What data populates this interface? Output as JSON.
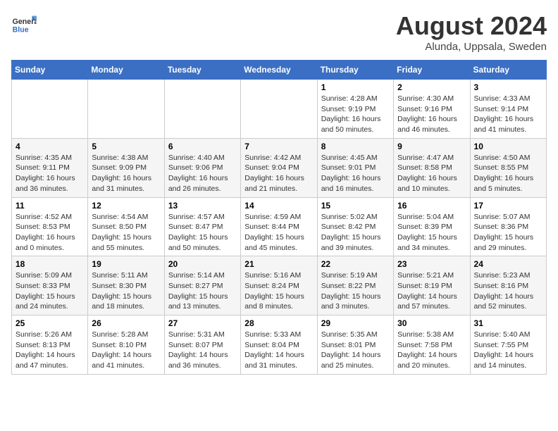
{
  "logo": {
    "line1": "General",
    "line2": "Blue"
  },
  "title": "August 2024",
  "location": "Alunda, Uppsala, Sweden",
  "weekdays": [
    "Sunday",
    "Monday",
    "Tuesday",
    "Wednesday",
    "Thursday",
    "Friday",
    "Saturday"
  ],
  "weeks": [
    [
      {
        "day": "",
        "info": ""
      },
      {
        "day": "",
        "info": ""
      },
      {
        "day": "",
        "info": ""
      },
      {
        "day": "",
        "info": ""
      },
      {
        "day": "1",
        "info": "Sunrise: 4:28 AM\nSunset: 9:19 PM\nDaylight: 16 hours\nand 50 minutes."
      },
      {
        "day": "2",
        "info": "Sunrise: 4:30 AM\nSunset: 9:16 PM\nDaylight: 16 hours\nand 46 minutes."
      },
      {
        "day": "3",
        "info": "Sunrise: 4:33 AM\nSunset: 9:14 PM\nDaylight: 16 hours\nand 41 minutes."
      }
    ],
    [
      {
        "day": "4",
        "info": "Sunrise: 4:35 AM\nSunset: 9:11 PM\nDaylight: 16 hours\nand 36 minutes."
      },
      {
        "day": "5",
        "info": "Sunrise: 4:38 AM\nSunset: 9:09 PM\nDaylight: 16 hours\nand 31 minutes."
      },
      {
        "day": "6",
        "info": "Sunrise: 4:40 AM\nSunset: 9:06 PM\nDaylight: 16 hours\nand 26 minutes."
      },
      {
        "day": "7",
        "info": "Sunrise: 4:42 AM\nSunset: 9:04 PM\nDaylight: 16 hours\nand 21 minutes."
      },
      {
        "day": "8",
        "info": "Sunrise: 4:45 AM\nSunset: 9:01 PM\nDaylight: 16 hours\nand 16 minutes."
      },
      {
        "day": "9",
        "info": "Sunrise: 4:47 AM\nSunset: 8:58 PM\nDaylight: 16 hours\nand 10 minutes."
      },
      {
        "day": "10",
        "info": "Sunrise: 4:50 AM\nSunset: 8:55 PM\nDaylight: 16 hours\nand 5 minutes."
      }
    ],
    [
      {
        "day": "11",
        "info": "Sunrise: 4:52 AM\nSunset: 8:53 PM\nDaylight: 16 hours\nand 0 minutes."
      },
      {
        "day": "12",
        "info": "Sunrise: 4:54 AM\nSunset: 8:50 PM\nDaylight: 15 hours\nand 55 minutes."
      },
      {
        "day": "13",
        "info": "Sunrise: 4:57 AM\nSunset: 8:47 PM\nDaylight: 15 hours\nand 50 minutes."
      },
      {
        "day": "14",
        "info": "Sunrise: 4:59 AM\nSunset: 8:44 PM\nDaylight: 15 hours\nand 45 minutes."
      },
      {
        "day": "15",
        "info": "Sunrise: 5:02 AM\nSunset: 8:42 PM\nDaylight: 15 hours\nand 39 minutes."
      },
      {
        "day": "16",
        "info": "Sunrise: 5:04 AM\nSunset: 8:39 PM\nDaylight: 15 hours\nand 34 minutes."
      },
      {
        "day": "17",
        "info": "Sunrise: 5:07 AM\nSunset: 8:36 PM\nDaylight: 15 hours\nand 29 minutes."
      }
    ],
    [
      {
        "day": "18",
        "info": "Sunrise: 5:09 AM\nSunset: 8:33 PM\nDaylight: 15 hours\nand 24 minutes."
      },
      {
        "day": "19",
        "info": "Sunrise: 5:11 AM\nSunset: 8:30 PM\nDaylight: 15 hours\nand 18 minutes."
      },
      {
        "day": "20",
        "info": "Sunrise: 5:14 AM\nSunset: 8:27 PM\nDaylight: 15 hours\nand 13 minutes."
      },
      {
        "day": "21",
        "info": "Sunrise: 5:16 AM\nSunset: 8:24 PM\nDaylight: 15 hours\nand 8 minutes."
      },
      {
        "day": "22",
        "info": "Sunrise: 5:19 AM\nSunset: 8:22 PM\nDaylight: 15 hours\nand 3 minutes."
      },
      {
        "day": "23",
        "info": "Sunrise: 5:21 AM\nSunset: 8:19 PM\nDaylight: 14 hours\nand 57 minutes."
      },
      {
        "day": "24",
        "info": "Sunrise: 5:23 AM\nSunset: 8:16 PM\nDaylight: 14 hours\nand 52 minutes."
      }
    ],
    [
      {
        "day": "25",
        "info": "Sunrise: 5:26 AM\nSunset: 8:13 PM\nDaylight: 14 hours\nand 47 minutes."
      },
      {
        "day": "26",
        "info": "Sunrise: 5:28 AM\nSunset: 8:10 PM\nDaylight: 14 hours\nand 41 minutes."
      },
      {
        "day": "27",
        "info": "Sunrise: 5:31 AM\nSunset: 8:07 PM\nDaylight: 14 hours\nand 36 minutes."
      },
      {
        "day": "28",
        "info": "Sunrise: 5:33 AM\nSunset: 8:04 PM\nDaylight: 14 hours\nand 31 minutes."
      },
      {
        "day": "29",
        "info": "Sunrise: 5:35 AM\nSunset: 8:01 PM\nDaylight: 14 hours\nand 25 minutes."
      },
      {
        "day": "30",
        "info": "Sunrise: 5:38 AM\nSunset: 7:58 PM\nDaylight: 14 hours\nand 20 minutes."
      },
      {
        "day": "31",
        "info": "Sunrise: 5:40 AM\nSunset: 7:55 PM\nDaylight: 14 hours\nand 14 minutes."
      }
    ]
  ]
}
